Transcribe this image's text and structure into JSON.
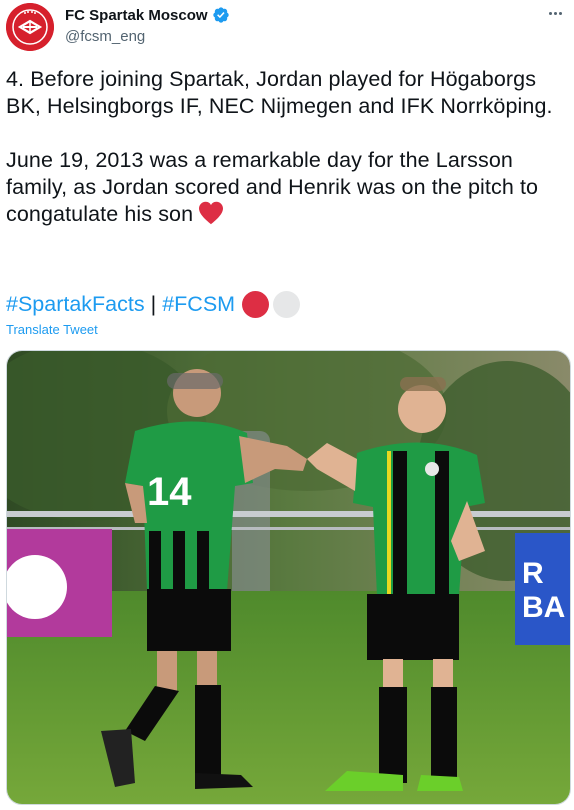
{
  "author": {
    "display_name": "FC Spartak Moscow",
    "handle": "@fcsm_eng",
    "avatar_icon": "spartak-logo-icon",
    "verified_icon": "verified-badge-icon"
  },
  "tweet": {
    "paragraph_1": "4. Before joining Spartak, Jordan played for Högaborgs BK, Helsingborgs IF, NEC Nijmegen and IFK Norrköping.",
    "paragraph_2": "June 19, 2013 was a remarkable day for the Larsson family, as Jordan scored and Henrik was on the pitch to congatulate his son",
    "heart_emoji": "red-heart-icon",
    "hashtag_1": "#SpartakFacts",
    "separator": "|",
    "hashtag_2": "#FCSM",
    "emoji_circles": [
      "red-circle-icon",
      "white-circle-icon"
    ],
    "translate_label": "Translate Tweet"
  },
  "media": {
    "jersey_number": "14",
    "sponsor_board_text": "R BA"
  },
  "colors": {
    "link": "#1d9bf0",
    "text": "#0f1419",
    "secondary": "#536471",
    "brand_red": "#d6202c"
  }
}
